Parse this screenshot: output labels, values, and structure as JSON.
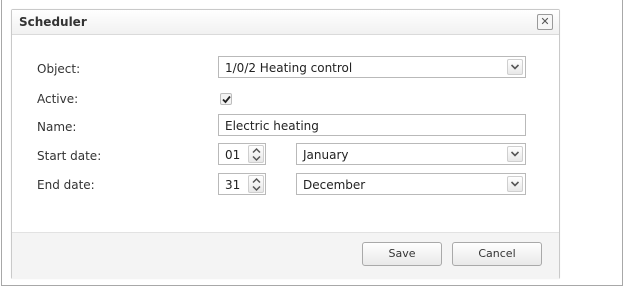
{
  "dialog": {
    "title": "Scheduler",
    "close_icon": "close-icon",
    "close_glyph": "✕"
  },
  "form": {
    "object_label": "Object:",
    "object_value": "1/0/2 Heating control",
    "active_label": "Active:",
    "active_checked": true,
    "name_label": "Name:",
    "name_value": "Electric heating",
    "start_label": "Start date:",
    "start_day": "01",
    "start_month": "January",
    "end_label": "End date:",
    "end_day": "31",
    "end_month": "December"
  },
  "buttons": {
    "save_label": "Save",
    "cancel_label": "Cancel"
  }
}
